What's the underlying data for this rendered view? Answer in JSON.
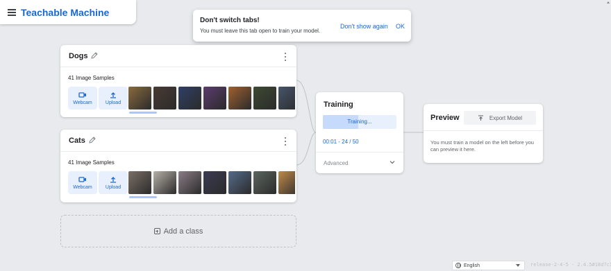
{
  "app": {
    "title": "Teachable Machine"
  },
  "toast": {
    "title": "Don't switch tabs!",
    "body": "You must leave this tab open to train your model.",
    "dismiss_label": "Don't show again",
    "ok_label": "OK"
  },
  "classes": [
    {
      "name": "Dogs",
      "samples_label": "41 Image Samples",
      "webcam_label": "Webcam",
      "upload_label": "Upload",
      "thumbs": [
        "#8a6a3e",
        "#4a3a34",
        "#2f3f66",
        "#5b3b6e",
        "#a0602f",
        "#3e4a32",
        "#46546a"
      ]
    },
    {
      "name": "Cats",
      "samples_label": "41 Image Samples",
      "webcam_label": "Webcam",
      "upload_label": "Upload",
      "thumbs": [
        "#7a6f66",
        "#b8b0a8",
        "#8b7d86",
        "#3a3b52",
        "#556b8a",
        "#5c6660",
        "#c08a4a"
      ]
    }
  ],
  "add_class": {
    "label": "Add a class"
  },
  "training": {
    "title": "Training",
    "button_label": "Training...",
    "progress_text": "00:01 - 24 / 50",
    "progress_fraction": 0.48,
    "advanced_label": "Advanced"
  },
  "preview": {
    "title": "Preview",
    "export_label": "Export Model",
    "message": "You must train a model on the left before you can preview it here."
  },
  "footer": {
    "language": "English",
    "version": "release-2-4-5 - 2.4.5#18d7c1"
  },
  "colors": {
    "accent": "#1967d2",
    "background": "#e8eaed",
    "button_bg": "#e8f0fe"
  }
}
